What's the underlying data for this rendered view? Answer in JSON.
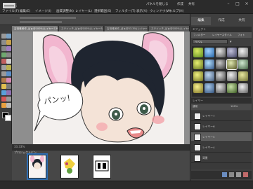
{
  "app": {
    "title": "編集",
    "menus": [
      "ファイル(F)",
      "編集(E)",
      "イメージ(I)",
      "画質調整(N)",
      "レイヤー(L)",
      "選択範囲(S)",
      "フィルター(T)",
      "表示(V)",
      "ウィンドウ(W)",
      "ヘルプ(H)"
    ],
    "topright": [
      "パネルを閉じる",
      "作成",
      "共有"
    ]
  },
  "document_tabs": [
    {
      "label": "吉田雅美作_ばぁ@100%(レイヤー7,RGB/8)*",
      "active": true
    },
    {
      "label": "ステイッチ_ばぁ@100%(レイヤー5,RGB/8)",
      "active": false
    },
    {
      "label": "吉田雅美作_ばぁ@33.3%(レイヤー5,RGB/8)",
      "active": false
    },
    {
      "label": "ステイッチ_ばぁ@100%(レイヤー2,RGB/8)",
      "active": false
    }
  ],
  "canvas": {
    "speech_text": "パンッ!",
    "status": "33.33%"
  },
  "project_bin": {
    "label": "プロジェクトビン",
    "items": [
      "thumbnail-1",
      "thumbnail-2",
      "thumbnail-3"
    ]
  },
  "panels": {
    "tabs": [
      "編集",
      "作成",
      "共有"
    ],
    "effects": {
      "header": "エフェクト",
      "subtabs": [
        "フィルター",
        "レイヤースタイル",
        "フォト"
      ],
      "dropdown": "ベベル"
    },
    "layers": {
      "header": "レイヤー",
      "mode": "通常",
      "opacity": "100%",
      "rows": [
        "レイヤー7",
        "レイヤー6",
        "レイヤー5",
        "レイヤー4",
        "背景"
      ]
    }
  },
  "colors": {
    "accent": "#2f6fb4",
    "panel_bg": "#3f3f3f"
  }
}
